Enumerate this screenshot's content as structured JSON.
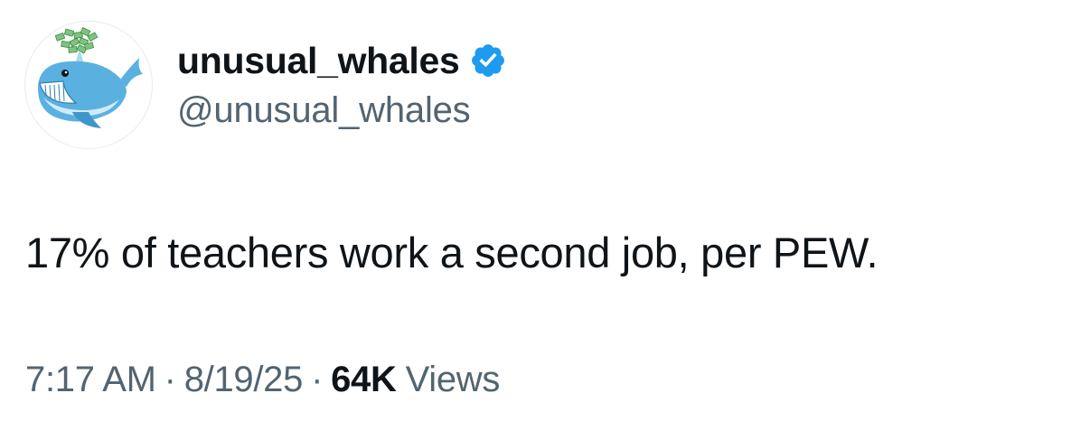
{
  "author": {
    "display_name": "unusual_whales",
    "handle": "@unusual_whales",
    "verified": true,
    "avatar_icon": "whale-icon",
    "verified_icon": "verified-badge-icon"
  },
  "tweet": {
    "text": "17% of teachers work a second job, per PEW."
  },
  "meta": {
    "time": "7:17 AM",
    "separator_1": "·",
    "date": "8/19/25",
    "separator_2": "·",
    "views_count": "64K",
    "views_label": "Views"
  },
  "colors": {
    "text_primary": "#0f1419",
    "text_secondary": "#536471",
    "verified_blue": "#1d9bf0",
    "whale_blue": "#5ab1e0",
    "money_green": "#6fbf73"
  }
}
